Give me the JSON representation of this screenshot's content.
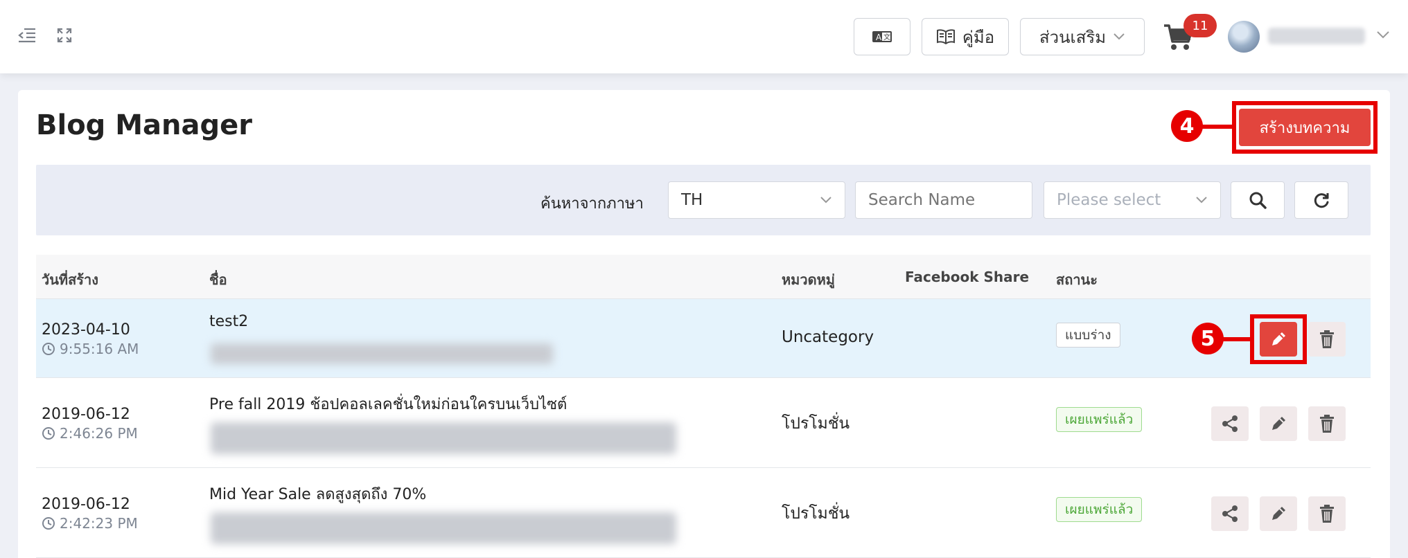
{
  "topbar": {
    "translate_icon": "translate-icon",
    "manual_label": "คู่มือ",
    "addons_label": "ส่วนเสริม",
    "cart_count": "11",
    "username_blurred": ""
  },
  "page": {
    "title": "Blog Manager",
    "create_label": "สร้างบทความ",
    "step_create": "4",
    "step_edit": "5"
  },
  "filter": {
    "language_label": "ค้นหาจากภาษา",
    "language_value": "TH",
    "search_placeholder": "Search Name",
    "category_placeholder": "Please select"
  },
  "table": {
    "headers": {
      "date": "วันที่สร้าง",
      "name": "ชื่อ",
      "category": "หมวดหมู่",
      "facebook": "Facebook Share",
      "status": "สถานะ"
    },
    "rows": [
      {
        "date": "2023-04-10",
        "time": "9:55:16 AM",
        "name": "test2",
        "category": "Uncategory",
        "status": "แบบร่าง"
      },
      {
        "date": "2019-06-12",
        "time": "2:46:26 PM",
        "name": "Pre fall 2019 ช้อปคอลเลคชั่นใหม่ก่อนใครบนเว็บไซต์",
        "category": "โปรโมชั่น",
        "status": "เผยแพร่แล้ว"
      },
      {
        "date": "2019-06-12",
        "time": "2:42:23 PM",
        "name": "Mid Year Sale ลดสูงสุดถึง 70%",
        "category": "โปรโมชั่น",
        "status": "เผยแพร่แล้ว"
      }
    ]
  },
  "colors": {
    "accent_red": "#e2453d",
    "highlight_red": "#e60000",
    "published_green": "#4ca737",
    "row_highlight": "#e5f3fc"
  }
}
